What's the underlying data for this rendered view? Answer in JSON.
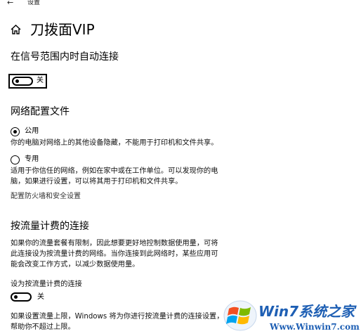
{
  "window": {
    "app_title": "设置",
    "back_icon": "back-arrow-icon"
  },
  "header": {
    "home_icon": "home-icon",
    "title": "刀拨面VIP"
  },
  "auto_connect": {
    "heading": "在信号范围内时自动连接",
    "toggle_label": "关",
    "toggle_on": false
  },
  "network_profile": {
    "heading": "网络配置文件",
    "public_label": "公用",
    "public_selected": true,
    "public_desc": "你的电脑对网络上的其他设备隐藏，不能用于打印机和文件共享。",
    "private_label": "专用",
    "private_selected": false,
    "private_desc_line1": "适用于你信任的网络，例如在家中或在工作单位。可以发现你的电",
    "private_desc_line2": "脑，如果进行设置，可以将其用于打印机和文件共享。",
    "firewall_link": "配置防火墙和安全设置"
  },
  "metered": {
    "heading": "按流量计费的连接",
    "desc_line1": "如果你的流量套餐有限制，因此想要更好地控制数据使用量，可将",
    "desc_line2": "此连接设为按流量计费的网络。当你连接到此网络时，某些应用可",
    "desc_line3": "能会改变工作方式，以减少数据使用量。",
    "set_label": "设为按流量计费的连接",
    "toggle_label": "关",
    "toggle_on": false,
    "limit_line1": "如果设置流量上限，Windows 将为你进行按流量计费的连接设置，",
    "limit_line2": "帮助你不超过上限。"
  },
  "watermark": {
    "brand": "Win7系统之家",
    "url": "Www.Winwin7.com",
    "logo_icon": "windows-logo-icon",
    "colors": {
      "red": "#f25022",
      "green": "#7fba00",
      "blue": "#00a4ef",
      "yellow": "#ffb900",
      "brand": "#1e5fb4"
    }
  }
}
